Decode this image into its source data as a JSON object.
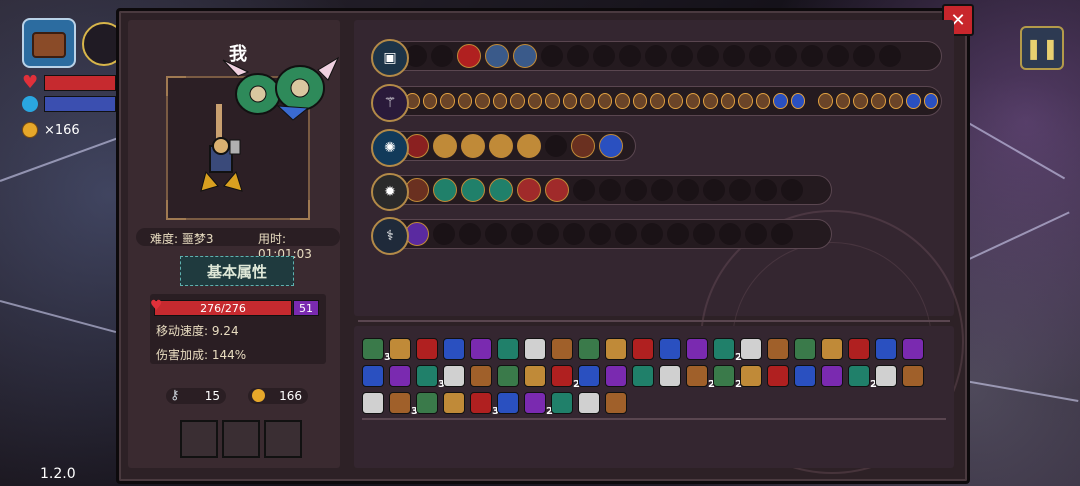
{
  "hud": {
    "gold_count": "×166",
    "version": "1.2.0",
    "pause_icon": "pause-icon",
    "hp_color": "#e0303a",
    "mana_color": "#2aa6e0"
  },
  "panel": {
    "close_label": "✕",
    "player_name": "我",
    "difficulty_label": "难度: 噩梦3",
    "time_label": "用时: 01:01:03",
    "stats_title": "基本属性",
    "hp_value": "276/276",
    "shield_value": "51",
    "move_speed": "移动速度: 9.24",
    "damage_bonus": "伤害加成: 144%",
    "keys": "15",
    "coins": "166"
  },
  "colors": {
    "accent_gold": "#c08a38",
    "panel_bg": "#2d2126",
    "hp_red": "#c62a2f",
    "shield_purple": "#7a2ab0",
    "stats_teal": "#1f3a3e"
  },
  "weapon_rows": [
    {
      "icon": "chest-icon",
      "filled": 4,
      "total": 20
    },
    {
      "icon": "staff-icon",
      "mini_count": 35
    },
    {
      "icon": "crystal-icon",
      "filled": 8,
      "total": 8
    },
    {
      "icon": "mace-icon",
      "filled": 5,
      "total": 15
    },
    {
      "icon": "wand-icon",
      "filled": 1,
      "total": 15
    }
  ],
  "item_counts": {
    "row1": [
      "3",
      "",
      "",
      "",
      "",
      "",
      "",
      "",
      "",
      "",
      "",
      "",
      "",
      "2",
      "",
      "",
      "",
      "",
      "",
      "",
      ""
    ],
    "row2": [
      "",
      "",
      "3",
      "",
      "",
      "",
      "",
      "2",
      "",
      "",
      "",
      "",
      "2",
      "2",
      "",
      "",
      "",
      "",
      "2",
      "",
      ""
    ],
    "row3": [
      "",
      "3",
      "",
      "",
      "3",
      "",
      "2",
      "",
      "",
      ""
    ]
  }
}
